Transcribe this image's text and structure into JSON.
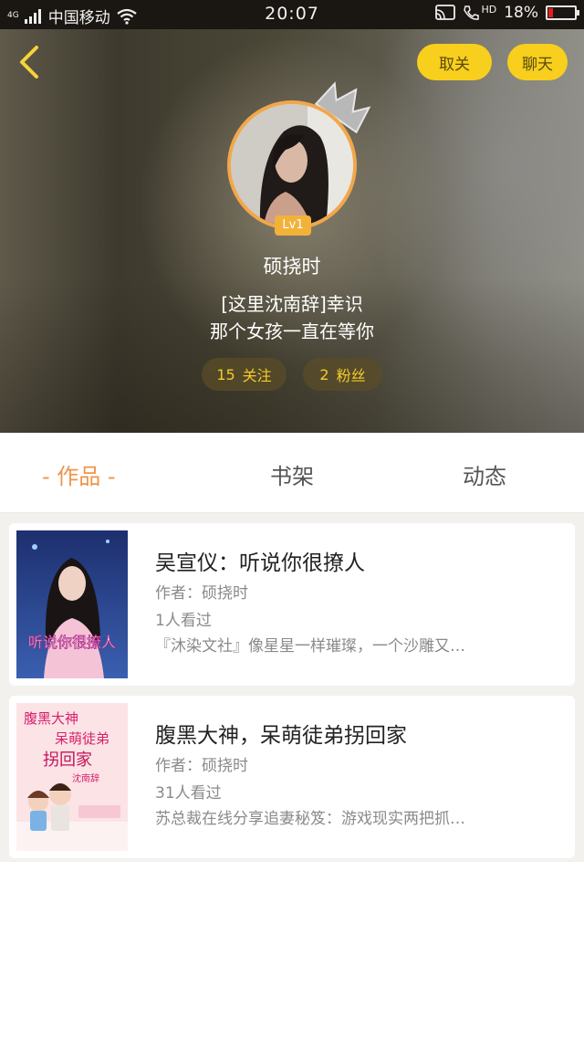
{
  "status_bar": {
    "signal_tag": "4G",
    "carrier": "中国移动",
    "time": "20:07",
    "hd": "HD",
    "battery_text": "18%",
    "battery_level": 0.18
  },
  "header": {
    "unfollow_label": "取关",
    "chat_label": "聊天"
  },
  "profile": {
    "level": "Lv1",
    "name": "硕挠时",
    "bio_line1": "[这里沈南辞]幸识",
    "bio_line2": "那个女孩一直在等你",
    "follow_count": "15",
    "follow_label": "关注",
    "fans_count": "2",
    "fans_label": "粉丝"
  },
  "tabs": {
    "works": "- 作品 -",
    "shelf": "书架",
    "feed": "动态"
  },
  "books": [
    {
      "title": "吴宣仪：听说你很撩人",
      "author": "作者：硕挠时",
      "views": "1人看过",
      "desc": "『沐染文社』像星星一样璀璨，一个沙雕又…",
      "cover_text": "听说你很撩人"
    },
    {
      "title": "腹黑大神，呆萌徒弟拐回家",
      "author": "作者：硕挠时",
      "views": "31人看过",
      "desc": "苏总裁在线分享追妻秘笈：游戏现实两把抓…",
      "cover_text_1": "腹黑大神",
      "cover_text_2": "呆萌徒弟",
      "cover_text_3": "拐回家",
      "cover_text_4": "沈南辞"
    }
  ],
  "colors": {
    "accent": "#f7cf1c",
    "active_tab": "#f0944a",
    "avatar_ring": "#f2a74a",
    "battery_low": "#e02020"
  },
  "icons": [
    "signal-icon",
    "wifi-icon",
    "cast-icon",
    "call-hd-icon",
    "battery-icon",
    "back-arrow-icon",
    "crown-icon"
  ]
}
